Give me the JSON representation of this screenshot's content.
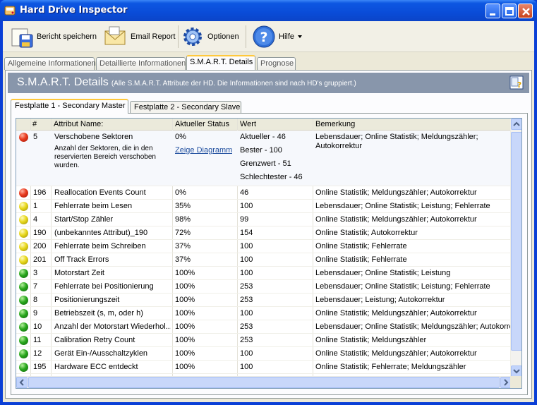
{
  "window": {
    "title": "Hard Drive Inspector"
  },
  "toolbar": {
    "save_label": "Bericht speichern",
    "email_label": "Email Report",
    "options_label": "Optionen",
    "help_label": "Hilfe"
  },
  "tabs": [
    {
      "label": "Allgemeine Informationen"
    },
    {
      "label": "Detaillierte Informationen"
    },
    {
      "label": "S.M.A.R.T. Details"
    },
    {
      "label": "Prognose"
    }
  ],
  "header": {
    "title": "S.M.A.R.T. Details",
    "subtitle": "(Alle S.M.A.R.T. Attribute der HD. Die Informationen sind nach HD's gruppiert.)"
  },
  "subtabs": [
    {
      "label": "Festplatte 1 - Secondary Master"
    },
    {
      "label": "Festplatte 2 - Secondary Slave"
    }
  ],
  "grid": {
    "columns": [
      "#",
      "Attribut Name:",
      "Aktueller Status",
      "Wert",
      "Bemerkung"
    ],
    "expanded": {
      "status_icon": "red",
      "num": "5",
      "name": "Verschobene Sektoren",
      "description": "Anzahl der Sektoren, die in den reservierten Bereich verschoben wurden.",
      "status": "0%",
      "diagram_link": "Zeige Diagramm",
      "values": [
        "Aktueller - 46",
        "Bester - 100",
        "Grenzwert - 51",
        "Schlechtester - 46"
      ],
      "remark": "Lebensdauer; Online Statistik; Meldungszähler; Autokorrektur"
    },
    "rows": [
      {
        "status_icon": "red",
        "num": "196",
        "name": "Reallocation Events Count",
        "status": "0%",
        "value": "46",
        "remark": "Online Statistik; Meldungszähler; Autokorrektur"
      },
      {
        "status_icon": "yellow",
        "num": "1",
        "name": "Fehlerrate beim Lesen",
        "status": "35%",
        "value": "100",
        "remark": "Lebensdauer; Online Statistik; Leistung; Fehlerrate"
      },
      {
        "status_icon": "yellow",
        "num": "4",
        "name": "Start/Stop Zähler",
        "status": "98%",
        "value": "99",
        "remark": "Online Statistik; Meldungszähler; Autokorrektur"
      },
      {
        "status_icon": "yellow",
        "num": "190",
        "name": "(unbekanntes Attribut)_190",
        "status": "72%",
        "value": "154",
        "remark": "Online Statistik; Autokorrektur"
      },
      {
        "status_icon": "yellow",
        "num": "200",
        "name": "Fehlerrate beim Schreiben",
        "status": "37%",
        "value": "100",
        "remark": "Online Statistik; Fehlerrate"
      },
      {
        "status_icon": "yellow",
        "num": "201",
        "name": "Off Track Errors",
        "status": "37%",
        "value": "100",
        "remark": "Online Statistik; Fehlerrate"
      },
      {
        "status_icon": "green",
        "num": "3",
        "name": "Motorstart Zeit",
        "status": "100%",
        "value": "100",
        "remark": "Lebensdauer; Online Statistik; Leistung"
      },
      {
        "status_icon": "green",
        "num": "7",
        "name": "Fehlerrate bei Positionierung",
        "status": "100%",
        "value": "253",
        "remark": "Lebensdauer; Online Statistik; Leistung; Fehlerrate"
      },
      {
        "status_icon": "green",
        "num": "8",
        "name": "Positionierungszeit",
        "status": "100%",
        "value": "253",
        "remark": "Lebensdauer; Leistung; Autokorrektur"
      },
      {
        "status_icon": "green",
        "num": "9",
        "name": "Betriebszeit (s, m, oder h)",
        "status": "100%",
        "value": "100",
        "remark": "Online Statistik; Meldungszähler; Autokorrektur"
      },
      {
        "status_icon": "green",
        "num": "10",
        "name": "Anzahl der Motorstart Wiederhol...",
        "status": "100%",
        "value": "253",
        "remark": "Lebensdauer; Online Statistik; Meldungszähler; Autokorrek"
      },
      {
        "status_icon": "green",
        "num": "11",
        "name": "Calibration Retry Count",
        "status": "100%",
        "value": "253",
        "remark": "Online Statistik; Meldungszähler"
      },
      {
        "status_icon": "green",
        "num": "12",
        "name": "Gerät Ein-/Ausschaltzyklen",
        "status": "100%",
        "value": "100",
        "remark": "Online Statistik; Meldungszähler; Autokorrektur"
      },
      {
        "status_icon": "green",
        "num": "195",
        "name": "Hardware ECC entdeckt",
        "status": "100%",
        "value": "100",
        "remark": "Online Statistik; Fehlerrate; Meldungszähler"
      }
    ]
  },
  "colors": {
    "red": "#e83a1e",
    "yellow": "#e8d81c",
    "green": "#2aa81e",
    "header_band": "#8896ab",
    "active_tab_accent": "#ffc83c"
  }
}
